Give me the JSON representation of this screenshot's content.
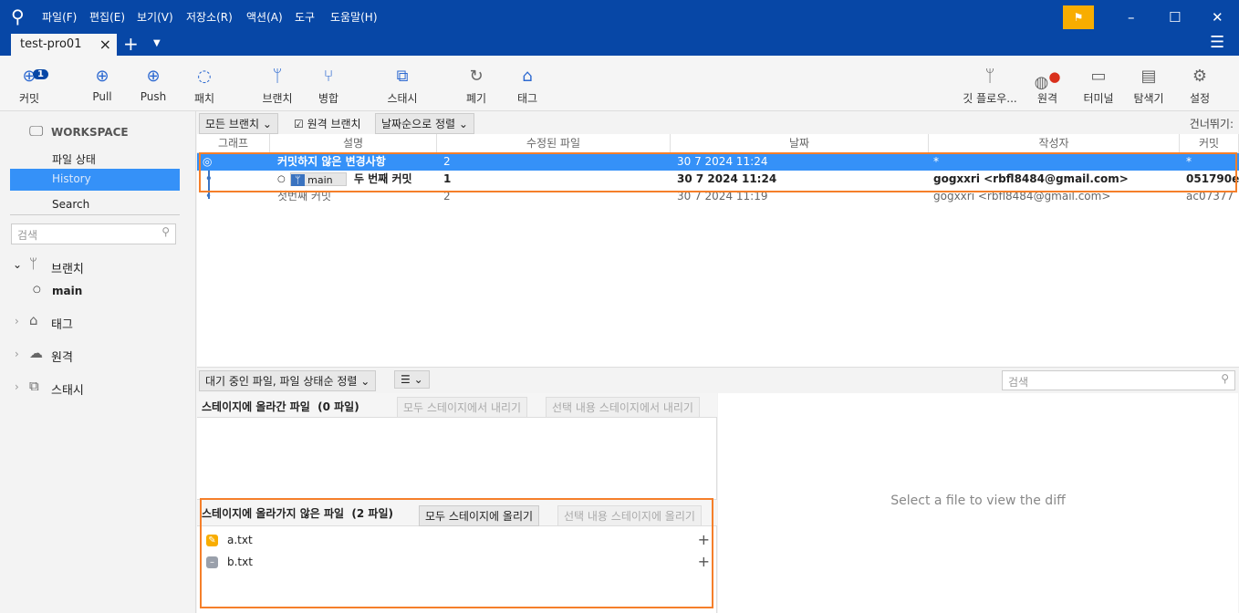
{
  "menu": [
    "파일(F)",
    "편집(E)",
    "보기(V)",
    "저장소(R)",
    "액션(A)",
    "도구",
    "도움말(H)"
  ],
  "tab": {
    "title": "test-pro01"
  },
  "toolbar": {
    "commit": "커밋",
    "commit_badge": "1",
    "pull": "Pull",
    "push": "Push",
    "fetch": "패치",
    "branch": "브랜치",
    "merge": "병합",
    "stash": "스태시",
    "discard": "폐기",
    "tag": "태그",
    "gitflow": "깃 플로우...",
    "remote": "원격",
    "terminal": "터미널",
    "explorer": "탐색기",
    "settings": "설정"
  },
  "sidebar": {
    "workspace": "WORKSPACE",
    "file_status": "파일 상태",
    "history": "History",
    "search": "Search",
    "search_placeholder": "검색",
    "branches": "브랜치",
    "main": "main",
    "tags": "태그",
    "remotes": "원격",
    "stashes": "스태시"
  },
  "filter": {
    "all_branches": "모든 브랜치",
    "remote_branches": "원격 브랜치",
    "sort": "날짜순으로 정렬",
    "skip": "건너뛰기:"
  },
  "columns": [
    "그래프",
    "설명",
    "수정된 파일",
    "날짜",
    "작성자",
    "커밋"
  ],
  "rows": [
    {
      "desc": "커밋하지 않은 변경사항",
      "files": "2",
      "date": "30 7 2024 11:24",
      "author": "*",
      "commit": "*"
    },
    {
      "branch": "main",
      "desc": "두 번째 커밋",
      "files": "1",
      "date": "30 7 2024 11:24",
      "author": "gogxxri <rbfl8484@gmail.com>",
      "commit": "051790e"
    },
    {
      "desc": "첫번째 커밋",
      "files": "2",
      "date": "30 7 2024 11:19",
      "author": "gogxxri <rbfl8484@gmail.com>",
      "commit": "ac07377"
    }
  ],
  "bottom": {
    "sort": "대기 중인 파일, 파일 상태순 정렬",
    "view": "☰",
    "search_placeholder": "검색"
  },
  "staged": {
    "title": "스테이지에 올라간 파일",
    "count": "(0 파일)",
    "unstage_all": "모두 스테이지에서 내리기",
    "unstage_sel": "선택 내용 스테이지에서 내리기"
  },
  "unstaged": {
    "title": "스테이지에 올라가지 않은 파일",
    "count": "(2 파일)",
    "stage_all": "모두 스테이지에 올리기",
    "stage_sel": "선택 내용 스테이지에 올리기",
    "files": [
      "a.txt",
      "b.txt"
    ]
  },
  "diff": {
    "placeholder": "Select a file to view the diff"
  }
}
